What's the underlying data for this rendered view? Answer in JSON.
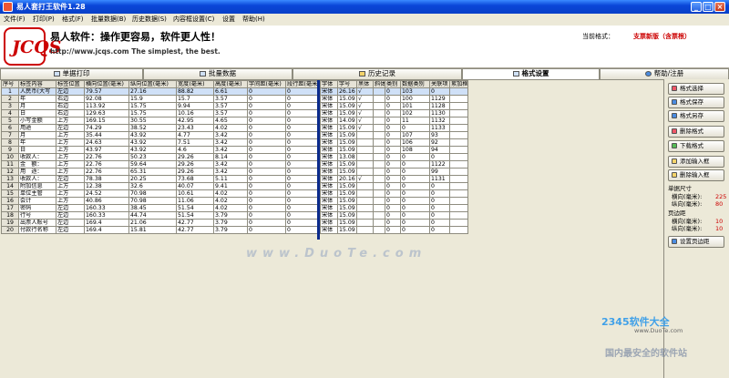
{
  "window": {
    "title": "易人套打王软件1.28",
    "min": "_",
    "max": "□",
    "close": "×"
  },
  "menu": [
    "文件(F)",
    "打印(P)",
    "格式(F)",
    "批量数据(B)",
    "历史数据(S)",
    "内容框设置(C)",
    "设置",
    "帮助(H)"
  ],
  "banner": {
    "logo": "JCQS",
    "slogan": "易人软件：操作更容易，软件更人性！",
    "site": "http://www.jcqs.com  The simplest, the best.",
    "format_label": "当前格式：",
    "format_value": "支票新版（含票根）"
  },
  "tabs": [
    "单据打印",
    "批量数据",
    "历史记录",
    "格式设置",
    "帮助/注册"
  ],
  "left_headers": [
    "序号",
    "标签内容",
    "标签位置",
    "横向位置(毫米)",
    "纵向位置(毫米)",
    "宽度(毫米)",
    "高度(毫米)",
    "字间距(毫米)",
    "段行距(毫米)"
  ],
  "right_headers": [
    "字体",
    "字号",
    "黑体",
    "斜体",
    "类别",
    "数据类别",
    "关联项",
    "累加框"
  ],
  "rows": [
    {
      "n": "1",
      "label": "人民币(大写",
      "pos": "左边",
      "h": "79.57",
      "v": "27.16",
      "w": "88.82",
      "ht": "6.61",
      "sp": "0",
      "ls": "0",
      "font": "宋体",
      "size": "26.16",
      "bold": "√",
      "italic": "",
      "cat": "0",
      "dcat": "103",
      "link": "0",
      "acc": ""
    },
    {
      "n": "2",
      "label": "年",
      "pos": "右边",
      "h": "92.08",
      "v": "15.9",
      "w": "15.7",
      "ht": "3.57",
      "sp": "0",
      "ls": "0",
      "font": "宋体",
      "size": "15.09",
      "bold": "√",
      "italic": "",
      "cat": "0",
      "dcat": "100",
      "link": "1129",
      "acc": ""
    },
    {
      "n": "3",
      "label": "月",
      "pos": "右边",
      "h": "113.92",
      "v": "15.75",
      "w": "9.94",
      "ht": "3.57",
      "sp": "0",
      "ls": "0",
      "font": "宋体",
      "size": "15.09",
      "bold": "√",
      "italic": "",
      "cat": "0",
      "dcat": "101",
      "link": "1128",
      "acc": ""
    },
    {
      "n": "4",
      "label": "日",
      "pos": "右边",
      "h": "129.63",
      "v": "15.75",
      "w": "10.16",
      "ht": "3.57",
      "sp": "0",
      "ls": "0",
      "font": "宋体",
      "size": "15.09",
      "bold": "√",
      "italic": "",
      "cat": "0",
      "dcat": "102",
      "link": "1130",
      "acc": ""
    },
    {
      "n": "5",
      "label": "小写金额",
      "pos": "上方",
      "h": "169.15",
      "v": "30.55",
      "w": "42.95",
      "ht": "4.65",
      "sp": "0",
      "ls": "0",
      "font": "宋体",
      "size": "14.09",
      "bold": "√",
      "italic": "",
      "cat": "0",
      "dcat": "11",
      "link": "1132",
      "acc": ""
    },
    {
      "n": "6",
      "label": "用途",
      "pos": "左边",
      "h": "74.29",
      "v": "38.52",
      "w": "23.43",
      "ht": "4.02",
      "sp": "0",
      "ls": "0",
      "font": "宋体",
      "size": "15.09",
      "bold": "√",
      "italic": "",
      "cat": "0",
      "dcat": "0",
      "link": "1133",
      "acc": ""
    },
    {
      "n": "7",
      "label": "月",
      "pos": "上方",
      "h": "35.44",
      "v": "43.92",
      "w": "4.77",
      "ht": "3.42",
      "sp": "0",
      "ls": "0",
      "font": "宋体",
      "size": "15.09",
      "bold": "",
      "italic": "",
      "cat": "0",
      "dcat": "107",
      "link": "93",
      "acc": ""
    },
    {
      "n": "8",
      "label": "年",
      "pos": "上方",
      "h": "24.63",
      "v": "43.92",
      "w": "7.51",
      "ht": "3.42",
      "sp": "0",
      "ls": "0",
      "font": "宋体",
      "size": "15.09",
      "bold": "",
      "italic": "",
      "cat": "0",
      "dcat": "106",
      "link": "92",
      "acc": ""
    },
    {
      "n": "9",
      "label": "日",
      "pos": "上方",
      "h": "43.97",
      "v": "43.92",
      "w": "4.6",
      "ht": "3.42",
      "sp": "0",
      "ls": "0",
      "font": "宋体",
      "size": "15.09",
      "bold": "",
      "italic": "",
      "cat": "0",
      "dcat": "108",
      "link": "94",
      "acc": ""
    },
    {
      "n": "10",
      "label": "收款人：",
      "pos": "上方",
      "h": "22.76",
      "v": "50.23",
      "w": "29.26",
      "ht": "8.14",
      "sp": "0",
      "ls": "0",
      "font": "宋体",
      "size": "13.08",
      "bold": "",
      "italic": "",
      "cat": "0",
      "dcat": "0",
      "link": "0",
      "acc": ""
    },
    {
      "n": "11",
      "label": "金　额：",
      "pos": "上方",
      "h": "22.76",
      "v": "59.64",
      "w": "29.26",
      "ht": "3.42",
      "sp": "0",
      "ls": "0",
      "font": "宋体",
      "size": "15.09",
      "bold": "",
      "italic": "",
      "cat": "0",
      "dcat": "0",
      "link": "1122",
      "acc": ""
    },
    {
      "n": "12",
      "label": "用　途：",
      "pos": "上方",
      "h": "22.76",
      "v": "65.31",
      "w": "29.26",
      "ht": "3.42",
      "sp": "0",
      "ls": "0",
      "font": "宋体",
      "size": "15.09",
      "bold": "",
      "italic": "",
      "cat": "0",
      "dcat": "0",
      "link": "99",
      "acc": ""
    },
    {
      "n": "13",
      "label": "收款人：",
      "pos": "左边",
      "h": "78.38",
      "v": "20.25",
      "w": "73.68",
      "ht": "5.11",
      "sp": "0",
      "ls": "0",
      "font": "宋体",
      "size": "20.16",
      "bold": "√",
      "italic": "",
      "cat": "0",
      "dcat": "0",
      "link": "1131",
      "acc": ""
    },
    {
      "n": "14",
      "label": "附加信息",
      "pos": "上方",
      "h": "12.38",
      "v": "32.6",
      "w": "40.07",
      "ht": "9.41",
      "sp": "0",
      "ls": "0",
      "font": "宋体",
      "size": "15.09",
      "bold": "",
      "italic": "",
      "cat": "0",
      "dcat": "0",
      "link": "0",
      "acc": ""
    },
    {
      "n": "15",
      "label": "单位主管",
      "pos": "上方",
      "h": "24.52",
      "v": "70.98",
      "w": "10.61",
      "ht": "4.02",
      "sp": "0",
      "ls": "0",
      "font": "宋体",
      "size": "15.09",
      "bold": "",
      "italic": "",
      "cat": "0",
      "dcat": "0",
      "link": "0",
      "acc": ""
    },
    {
      "n": "16",
      "label": "会计",
      "pos": "上方",
      "h": "40.86",
      "v": "70.98",
      "w": "11.06",
      "ht": "4.02",
      "sp": "0",
      "ls": "0",
      "font": "宋体",
      "size": "15.09",
      "bold": "",
      "italic": "",
      "cat": "0",
      "dcat": "0",
      "link": "0",
      "acc": ""
    },
    {
      "n": "17",
      "label": "密码",
      "pos": "左边",
      "h": "160.33",
      "v": "38.45",
      "w": "51.54",
      "ht": "4.02",
      "sp": "0",
      "ls": "0",
      "font": "宋体",
      "size": "15.09",
      "bold": "",
      "italic": "",
      "cat": "0",
      "dcat": "0",
      "link": "0",
      "acc": ""
    },
    {
      "n": "18",
      "label": "行号",
      "pos": "左边",
      "h": "160.33",
      "v": "44.74",
      "w": "51.54",
      "ht": "3.79",
      "sp": "0",
      "ls": "0",
      "font": "宋体",
      "size": "15.09",
      "bold": "",
      "italic": "",
      "cat": "0",
      "dcat": "0",
      "link": "0",
      "acc": ""
    },
    {
      "n": "19",
      "label": "出票人账号",
      "pos": "左边",
      "h": "169.4",
      "v": "21.06",
      "w": "42.77",
      "ht": "3.79",
      "sp": "0",
      "ls": "0",
      "font": "宋体",
      "size": "15.09",
      "bold": "",
      "italic": "",
      "cat": "0",
      "dcat": "0",
      "link": "0",
      "acc": ""
    },
    {
      "n": "20",
      "label": "付款行名称",
      "pos": "左边",
      "h": "169.4",
      "v": "15.81",
      "w": "42.77",
      "ht": "3.79",
      "sp": "0",
      "ls": "0",
      "font": "宋体",
      "size": "15.09",
      "bold": "",
      "italic": "",
      "cat": "0",
      "dcat": "0",
      "link": "0",
      "acc": ""
    }
  ],
  "side": {
    "buttons": [
      "格式选择",
      "格式保存",
      "格式另存",
      "删除格式",
      "下载格式",
      "添加输入框",
      "删除输入框"
    ],
    "voucher_size_label": "单据尺寸",
    "width_label": "横向(毫米):",
    "width_value": "225",
    "height_label": "纵向(毫米):",
    "height_value": "80",
    "margin_label": "页边距",
    "margin_h_label": "横向(毫米):",
    "margin_h_value": "10",
    "margin_v_label": "纵向(毫米):",
    "margin_v_value": "10",
    "margin_button": "设置页边距"
  },
  "watermark": "www.DuoTe.com",
  "corner": {
    "logo": "2345软件大全",
    "url": "www.DuoTe.com",
    "slogan": "国内最安全的软件站"
  },
  "colors": {
    "accent": "#0A46D8",
    "alert": "#CC0000"
  }
}
